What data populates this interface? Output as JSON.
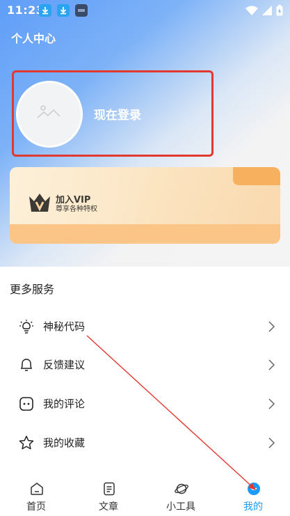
{
  "status_bar": {
    "time": "11:23",
    "notification_icons": [
      "download-icon",
      "download-icon",
      "hms-icon"
    ],
    "right_icons": [
      "wifi-icon",
      "signal-icon",
      "battery-icon"
    ]
  },
  "header": {
    "title": "个人中心",
    "login_text": "现在登录",
    "avatar_icon": "image-placeholder-icon"
  },
  "vip": {
    "title": "加入VIP",
    "subtitle": "尊享各种特权",
    "icon": "crown-icon",
    "accent": "#f7b15e"
  },
  "services": {
    "title": "更多服务",
    "items": [
      {
        "label": "神秘代码",
        "icon": "lightbulb-icon"
      },
      {
        "label": "反馈建议",
        "icon": "bell-icon"
      },
      {
        "label": "我的评论",
        "icon": "comment-icon"
      },
      {
        "label": "我的收藏",
        "icon": "star-icon"
      }
    ]
  },
  "tabbar": {
    "active": "我的",
    "active_color": "#1b9af7",
    "tabs": [
      {
        "label": "首页",
        "icon": "home-icon"
      },
      {
        "label": "文章",
        "icon": "article-icon"
      },
      {
        "label": "小工具",
        "icon": "planet-icon"
      },
      {
        "label": "我的",
        "icon": "profile-icon"
      }
    ]
  },
  "annotation": {
    "highlight_color": "#e1382f"
  }
}
